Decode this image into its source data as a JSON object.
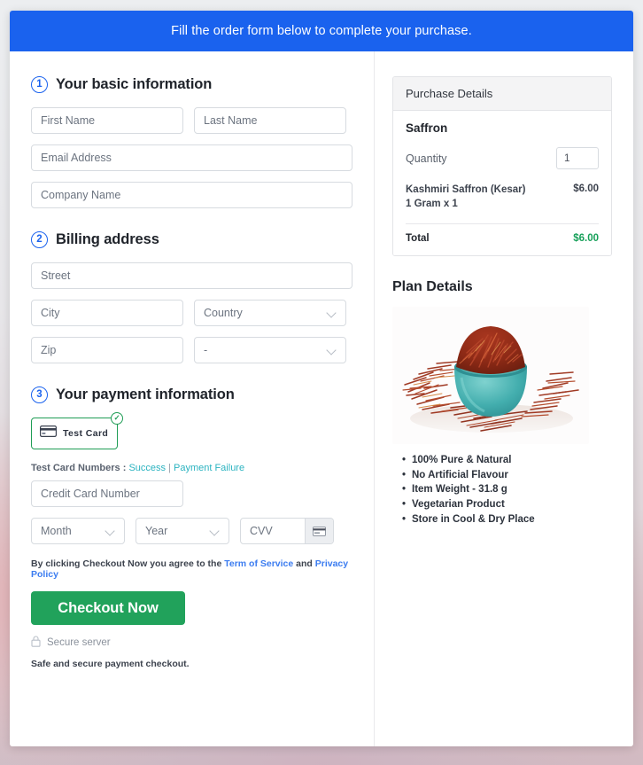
{
  "banner": {
    "text": "Fill the order form below to complete your purchase."
  },
  "sections": {
    "basic": {
      "number": "1",
      "title": "Your basic information"
    },
    "billing": {
      "number": "2",
      "title": "Billing address"
    },
    "payment": {
      "number": "3",
      "title": "Your payment information"
    }
  },
  "fields": {
    "first_name": "First Name",
    "last_name": "Last Name",
    "email": "Email Address",
    "company": "Company Name",
    "street": "Street",
    "city": "City",
    "country": "Country",
    "zip": "Zip",
    "state": "-",
    "credit_card": "Credit Card Number",
    "month": "Month",
    "year": "Year",
    "cvv": "CVV"
  },
  "payment": {
    "test_card_label": "Test Card",
    "check_badge": "✓",
    "test_numbers_prefix": "Test Card Numbers : ",
    "success_link": "Success",
    "separator": " | ",
    "failure_link": "Payment Failure"
  },
  "agreement": {
    "prefix": "By clicking Checkout Now you agree to the ",
    "terms_link": "Term of Service",
    "middle": " and ",
    "privacy_link": "Privacy Policy"
  },
  "actions": {
    "checkout_label": "Checkout Now",
    "secure_server": "Secure server",
    "safe_note": "Safe and secure payment checkout."
  },
  "purchase": {
    "header": "Purchase Details",
    "product_name": "Saffron",
    "quantity_label": "Quantity",
    "quantity_value": "1",
    "line_item_name": "Kashmiri Saffron (Kesar) 1 Gram x 1",
    "line_item_price": "$6.00",
    "total_label": "Total",
    "total_value": "$6.00"
  },
  "plan": {
    "title": "Plan Details",
    "image_alt": "saffron-threads-in-teal-bowl",
    "bullets": [
      "100% Pure & Natural",
      "No Artificial Flavour",
      "Item Weight - 31.8 g",
      "Vegetarian Product",
      "Store in Cool & Dry Place"
    ]
  },
  "colors": {
    "banner_blue": "#1a62ee",
    "accent_green": "#21a25b",
    "total_green": "#18a05a",
    "link_blue": "#3b7cf0",
    "link_teal": "#2bb3c0",
    "card_border_green": "#1f9d55"
  }
}
